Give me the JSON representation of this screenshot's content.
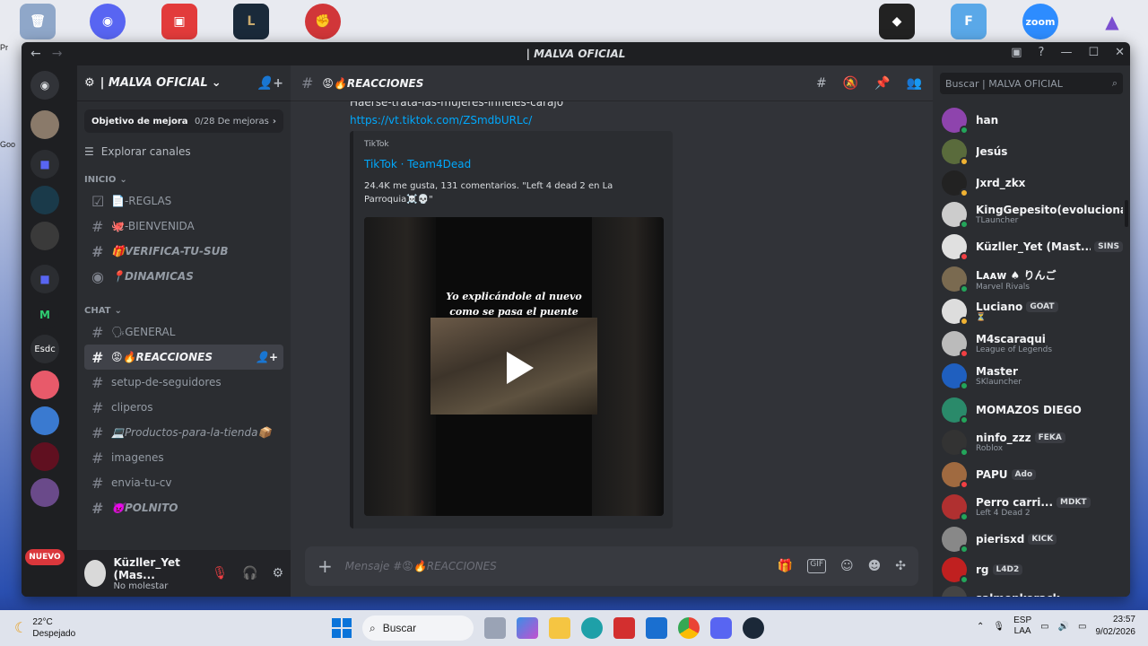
{
  "window": {
    "title": "| MALVA OFICIAL"
  },
  "server": {
    "name": "| MALVA OFICIAL",
    "new_badge": "NUEVO"
  },
  "goal": {
    "label": "Objetivo de mejora",
    "value": "0/28 De mejoras"
  },
  "explore_label": "Explorar canales",
  "categories": {
    "inicio": "INICIO",
    "chat": "CHAT"
  },
  "channels_inicio": [
    {
      "label": "📄-REGLAS"
    },
    {
      "label": "🐙-BIENVENIDA"
    },
    {
      "label": "🎁VERIFICA-TU-SUB"
    },
    {
      "label": "📍DINAMICAS"
    }
  ],
  "channels_chat": [
    {
      "label": "🗣GENERAL"
    },
    {
      "label": "😡🔥REACCIONES"
    },
    {
      "label": "setup-de-seguidores"
    },
    {
      "label": "cliperos"
    },
    {
      "label": "💻Productos-para-la-tienda📦"
    },
    {
      "label": "imagenes"
    },
    {
      "label": "envia-tu-cv"
    },
    {
      "label": "👿POLNITO"
    }
  ],
  "user_panel": {
    "name": "Küzller_Yet (Mas...",
    "status": "No molestar"
  },
  "main": {
    "channel_title": "😡🔥REACCIONES",
    "msg_cut": "Haerse-trata-las-mujeres-infieles-carajo",
    "link": "https://vt.tiktok.com/ZSmdbURLc/",
    "embed": {
      "provider": "TikTok",
      "title": "TikTok · Team4Dead",
      "description": "24.4K me gusta, 131 comentarios. \"Left 4 dead 2 en La Parroquia☠️💀\"",
      "video_caption_1": "Yo explicándole al nuevo",
      "video_caption_2": "como se pasa el puente"
    },
    "composer_placeholder": "Mensaje #😡🔥REACCIONES"
  },
  "members": {
    "search_placeholder": "Buscar | MALVA OFICIAL",
    "list": [
      {
        "name": "han",
        "activity": "",
        "tag": "",
        "color": "#8e44ad",
        "status": "#23a55a"
      },
      {
        "name": "Jesús",
        "activity": "",
        "tag": "",
        "color": "#5a6b3c",
        "status": "#f0b232"
      },
      {
        "name": "Jxrd_zkx",
        "activity": "",
        "tag": "",
        "color": "#222222",
        "status": "#f0b232"
      },
      {
        "name": "KingGepesito(evoluciona...",
        "activity": "TLauncher",
        "tag": "",
        "color": "#cccccc",
        "status": "#23a55a"
      },
      {
        "name": "Küzller_Yet (Mast...",
        "activity": "",
        "tag": "SINS",
        "color": "#e0e0e0",
        "status": "#f23f43"
      },
      {
        "name": "Lᴀᴀᴡ ♠ りんご",
        "activity": "Marvel Rivals",
        "tag": "",
        "color": "#7a6a50",
        "status": "#23a55a"
      },
      {
        "name": "Luciano",
        "activity": "⏳",
        "tag": "GOAT",
        "color": "#dddddd",
        "status": "#f0b232"
      },
      {
        "name": "M4scaraqui",
        "activity": "League of Legends",
        "tag": "",
        "color": "#bbbbbb",
        "status": "#f23f43"
      },
      {
        "name": "Master",
        "activity": "SKlauncher",
        "tag": "",
        "color": "#1f5fbf",
        "status": "#23a55a"
      },
      {
        "name": "MOMAZOS DIEGO",
        "activity": "",
        "tag": "",
        "color": "#2a8a6a",
        "status": "#23a55a"
      },
      {
        "name": "ninfo_zzz",
        "activity": "Roblox",
        "tag": "FEKA",
        "color": "#333333",
        "status": "#23a55a"
      },
      {
        "name": "PAPU",
        "activity": "",
        "tag": "Ado",
        "color": "#a06a40",
        "status": "#f23f43"
      },
      {
        "name": "Perro carri...",
        "activity": "Left 4 Dead 2",
        "tag": "MDKT",
        "color": "#b03030",
        "status": "#23a55a"
      },
      {
        "name": "pierisxd",
        "activity": "",
        "tag": "KICK",
        "color": "#888888",
        "status": "#23a55a"
      },
      {
        "name": "rg",
        "activity": "",
        "tag": "L4D2",
        "color": "#c02020",
        "status": "#23a55a"
      },
      {
        "name": "salmonkorack",
        "activity": "",
        "tag": "",
        "color": "#444444",
        "status": "#23a55a"
      }
    ]
  },
  "taskbar": {
    "temp": "22°C",
    "weather": "Despejado",
    "search": "Buscar",
    "lang_1": "ESP",
    "lang_2": "LAA",
    "time": "23:57",
    "date": "9/02/2026"
  },
  "desktop": {
    "side_1": "Pr",
    "side_2": "Goo",
    "side_3": "Esdc"
  }
}
